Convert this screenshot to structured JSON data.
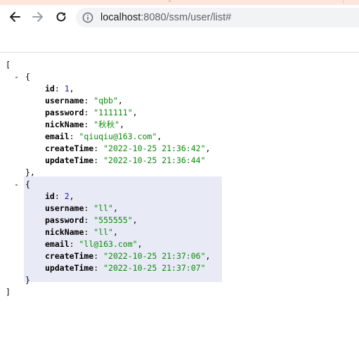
{
  "browser": {
    "back_icon": "arrow-left-icon",
    "forward_icon": "arrow-right-icon",
    "reload_icon": "reload-icon",
    "info_icon": "info-circle-icon",
    "url_host": "localhost",
    "url_path": ":8080/ssm/user/list#"
  },
  "json_view": {
    "open_bracket": "[",
    "close_bracket": "]",
    "collapse_symbol": "-",
    "records": [
      {
        "fields": [
          {
            "key": "id",
            "value": "1",
            "type": "number"
          },
          {
            "key": "username",
            "value": "\"qbb\"",
            "type": "string"
          },
          {
            "key": "password",
            "value": "\"111111\"",
            "type": "string"
          },
          {
            "key": "nickName",
            "value": "\"秋秋\"",
            "type": "string"
          },
          {
            "key": "email",
            "value": "\"qiuqiu@163.com\"",
            "type": "string"
          },
          {
            "key": "createTime",
            "value": "\"2022-10-25 21:36:42\"",
            "type": "string"
          },
          {
            "key": "updateTime",
            "value": "\"2022-10-25 21:36:44\"",
            "type": "string"
          }
        ]
      },
      {
        "fields": [
          {
            "key": "id",
            "value": "2",
            "type": "number"
          },
          {
            "key": "username",
            "value": "\"ll\"",
            "type": "string"
          },
          {
            "key": "password",
            "value": "\"555555\"",
            "type": "string"
          },
          {
            "key": "nickName",
            "value": "\"ll\"",
            "type": "string"
          },
          {
            "key": "email",
            "value": "\"ll@163.com\"",
            "type": "string"
          },
          {
            "key": "createTime",
            "value": "\"2022-10-25 21:37:06\"",
            "type": "string"
          },
          {
            "key": "updateTime",
            "value": "\"2022-10-25 21:37:07\"",
            "type": "string"
          }
        ]
      }
    ]
  },
  "colors": {
    "string": "#0a8a0a",
    "number": "#1a1aa6",
    "highlight": "#e8eaf6"
  }
}
